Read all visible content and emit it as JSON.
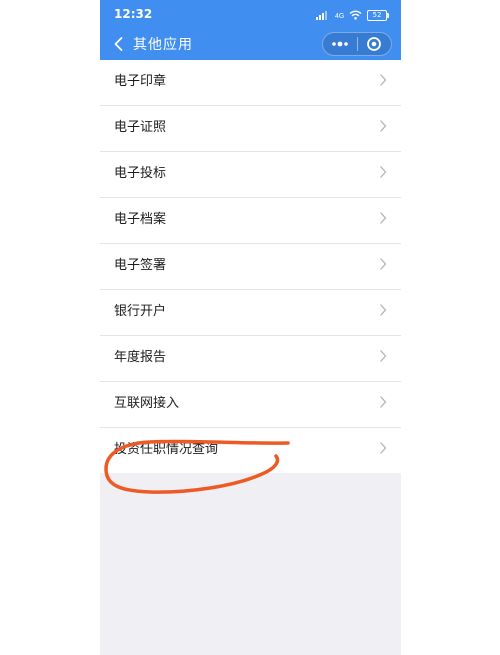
{
  "status_bar": {
    "time": "12:32",
    "battery": "52"
  },
  "nav": {
    "title": "其他应用",
    "icons": {
      "back": "chevron-left-icon",
      "more": "more-dots-icon",
      "close": "target-close-icon"
    }
  },
  "menu": {
    "items": [
      {
        "label": "电子印章"
      },
      {
        "label": "电子证照"
      },
      {
        "label": "电子投标"
      },
      {
        "label": "电子档案"
      },
      {
        "label": "电子签署"
      },
      {
        "label": "银行开户"
      },
      {
        "label": "年度报告"
      },
      {
        "label": "互联网接入"
      },
      {
        "label": "投资任职情况查询"
      }
    ]
  },
  "colors": {
    "accent": "#3f8ef0",
    "background": "#efeff4",
    "annotation": "#ee5a24"
  }
}
